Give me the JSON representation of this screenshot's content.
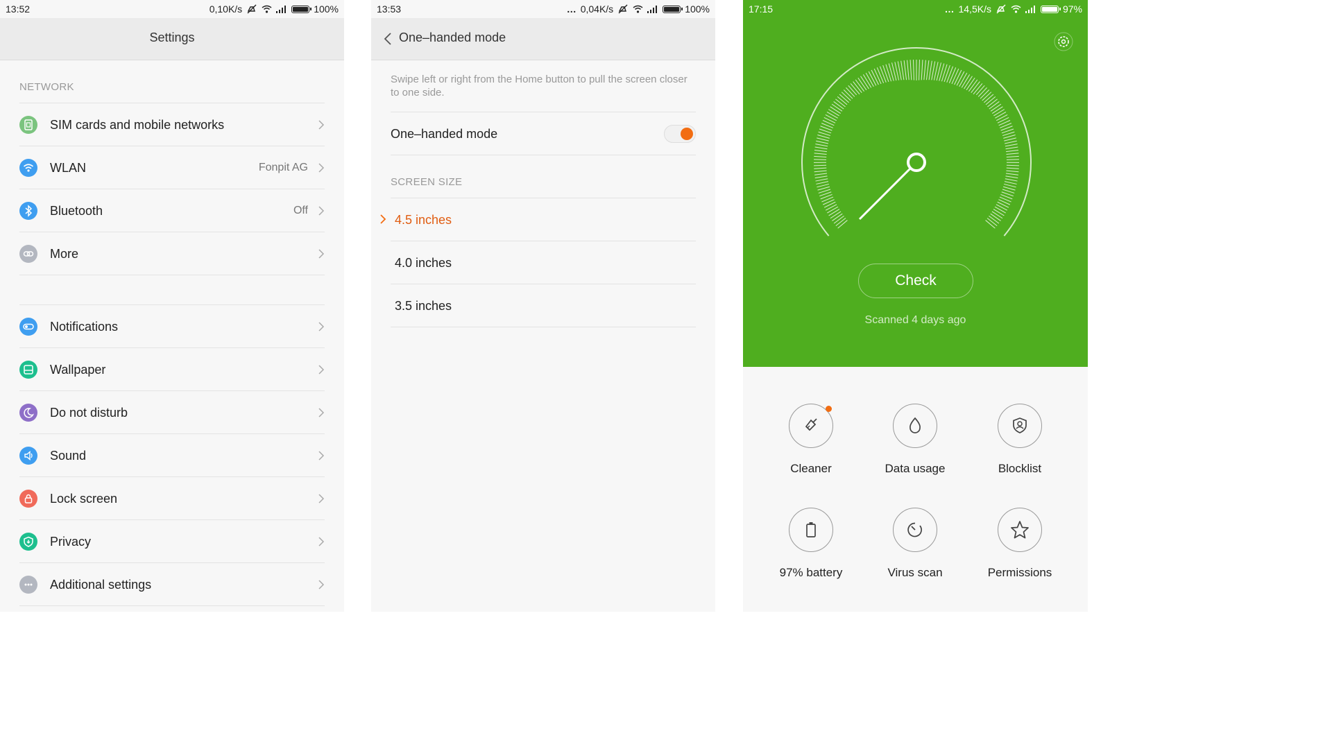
{
  "screen1": {
    "status": {
      "time": "13:52",
      "speed": "0,10K/s",
      "battery": "100%"
    },
    "title": "Settings",
    "network_header": "NETWORK",
    "items": [
      {
        "label": "SIM cards and mobile networks",
        "value": "",
        "icon": "sim-card-icon",
        "color": "#7bc47f"
      },
      {
        "label": "WLAN",
        "value": "Fonpit AG",
        "icon": "wifi-icon",
        "color": "#3f9ef0"
      },
      {
        "label": "Bluetooth",
        "value": "Off",
        "icon": "bluetooth-icon",
        "color": "#3f9ef0"
      },
      {
        "label": "More",
        "value": "",
        "icon": "link-icon",
        "color": "#b3b7c0"
      },
      {
        "label": "Notifications",
        "value": "",
        "icon": "notifications-icon",
        "color": "#3f9ef0"
      },
      {
        "label": "Wallpaper",
        "value": "",
        "icon": "wallpaper-icon",
        "color": "#1dbf8e"
      },
      {
        "label": "Do not disturb",
        "value": "",
        "icon": "moon-icon",
        "color": "#8e6fc8"
      },
      {
        "label": "Sound",
        "value": "",
        "icon": "sound-icon",
        "color": "#3f9ef0"
      },
      {
        "label": "Lock screen",
        "value": "",
        "icon": "lock-icon",
        "color": "#f06a5a"
      },
      {
        "label": "Privacy",
        "value": "",
        "icon": "shield-icon",
        "color": "#1dbf8e"
      },
      {
        "label": "Additional settings",
        "value": "",
        "icon": "more-dots-icon",
        "color": "#b3b7c0"
      }
    ]
  },
  "screen2": {
    "status": {
      "time": "13:53",
      "speed": "0,04K/s",
      "battery": "100%"
    },
    "title": "One–handed mode",
    "description": "Swipe left or right from the Home button to pull the screen closer to one side.",
    "toggle_label": "One–handed mode",
    "toggle_on": true,
    "section_header": "SCREEN SIZE",
    "sizes": [
      {
        "label": "4.5 inches",
        "selected": true
      },
      {
        "label": "4.0 inches",
        "selected": false
      },
      {
        "label": "3.5 inches",
        "selected": false
      }
    ],
    "accent": "#f26d12"
  },
  "screen3": {
    "status": {
      "time": "17:15",
      "speed": "14,5K/s",
      "battery": "97%"
    },
    "check_label": "Check",
    "scanned": "Scanned 4 days ago",
    "green": "#4fae1f",
    "tools": [
      {
        "label": "Cleaner",
        "icon": "broom-icon",
        "badge": true
      },
      {
        "label": "Data usage",
        "icon": "droplet-icon",
        "badge": false
      },
      {
        "label": "Blocklist",
        "icon": "shield-user-icon",
        "badge": false
      },
      {
        "label": "97% battery",
        "icon": "battery-icon",
        "badge": false
      },
      {
        "label": "Virus scan",
        "icon": "scan-icon",
        "badge": false
      },
      {
        "label": "Permissions",
        "icon": "star-icon",
        "badge": false
      }
    ]
  }
}
